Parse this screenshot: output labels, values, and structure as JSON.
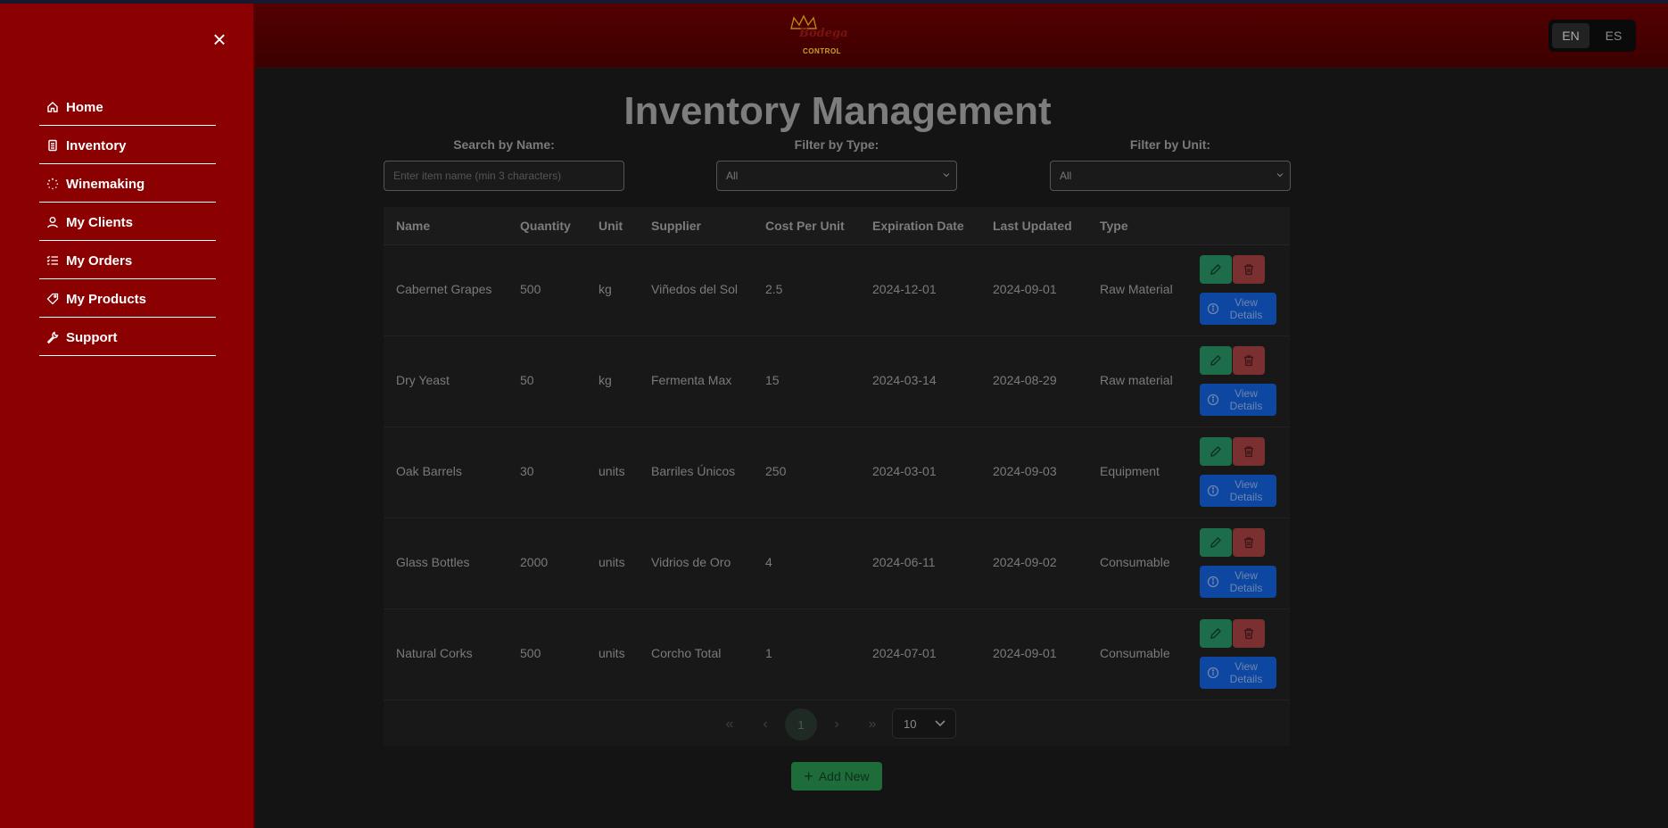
{
  "sidebar": {
    "close_glyph": "×",
    "items": [
      {
        "label": "Home",
        "icon": "home-icon"
      },
      {
        "label": "Inventory",
        "icon": "clipboard-icon"
      },
      {
        "label": "Winemaking",
        "icon": "loader-icon"
      },
      {
        "label": "My Clients",
        "icon": "user-icon"
      },
      {
        "label": "My Orders",
        "icon": "list-check-icon"
      },
      {
        "label": "My Products",
        "icon": "tag-icon"
      },
      {
        "label": "Support",
        "icon": "wrench-icon"
      }
    ]
  },
  "header": {
    "logo_text": "Bodega",
    "logo_sub": "CONTROL",
    "languages": [
      "EN",
      "ES"
    ],
    "active_language": "EN"
  },
  "main": {
    "title": "Inventory Management",
    "filters": {
      "search_label": "Search by Name:",
      "search_placeholder": "Enter item name (min 3 characters)",
      "type_label": "Filter by Type:",
      "type_value": "All",
      "unit_label": "Filter by Unit:",
      "unit_value": "All"
    },
    "table": {
      "columns": [
        "Name",
        "Quantity",
        "Unit",
        "Supplier",
        "Cost Per Unit",
        "Expiration Date",
        "Last Updated",
        "Type"
      ],
      "rows": [
        [
          "Cabernet Grapes",
          "500",
          "kg",
          "Viñedos del Sol",
          "2.5",
          "2024-12-01",
          "2024-09-01",
          "Raw Material"
        ],
        [
          "Dry Yeast",
          "50",
          "kg",
          "Fermenta Max",
          "15",
          "2024-03-14",
          "2024-08-29",
          "Raw material"
        ],
        [
          "Oak Barrels",
          "30",
          "units",
          "Barriles Únicos",
          "250",
          "2024-03-01",
          "2024-09-03",
          "Equipment"
        ],
        [
          "Glass Bottles",
          "2000",
          "units",
          "Vidrios de Oro",
          "4",
          "2024-06-11",
          "2024-09-02",
          "Consumable"
        ],
        [
          "Natural Corks",
          "500",
          "units",
          "Corcho Total",
          "1",
          "2024-07-01",
          "2024-09-01",
          "Consumable"
        ]
      ],
      "view_label": "View Details"
    },
    "pagination": {
      "first": "«",
      "prev": "‹",
      "current": "1",
      "next": "›",
      "last": "»",
      "page_size": "10"
    },
    "add_label": "Add New"
  },
  "colors": {
    "sidebar_bg": "#8b0000",
    "header_bg": "#4a0000",
    "edit_btn": "#1d6c4a",
    "delete_btn": "#7a3030",
    "view_btn": "#0d47a1",
    "add_btn": "#1d6c3a"
  }
}
